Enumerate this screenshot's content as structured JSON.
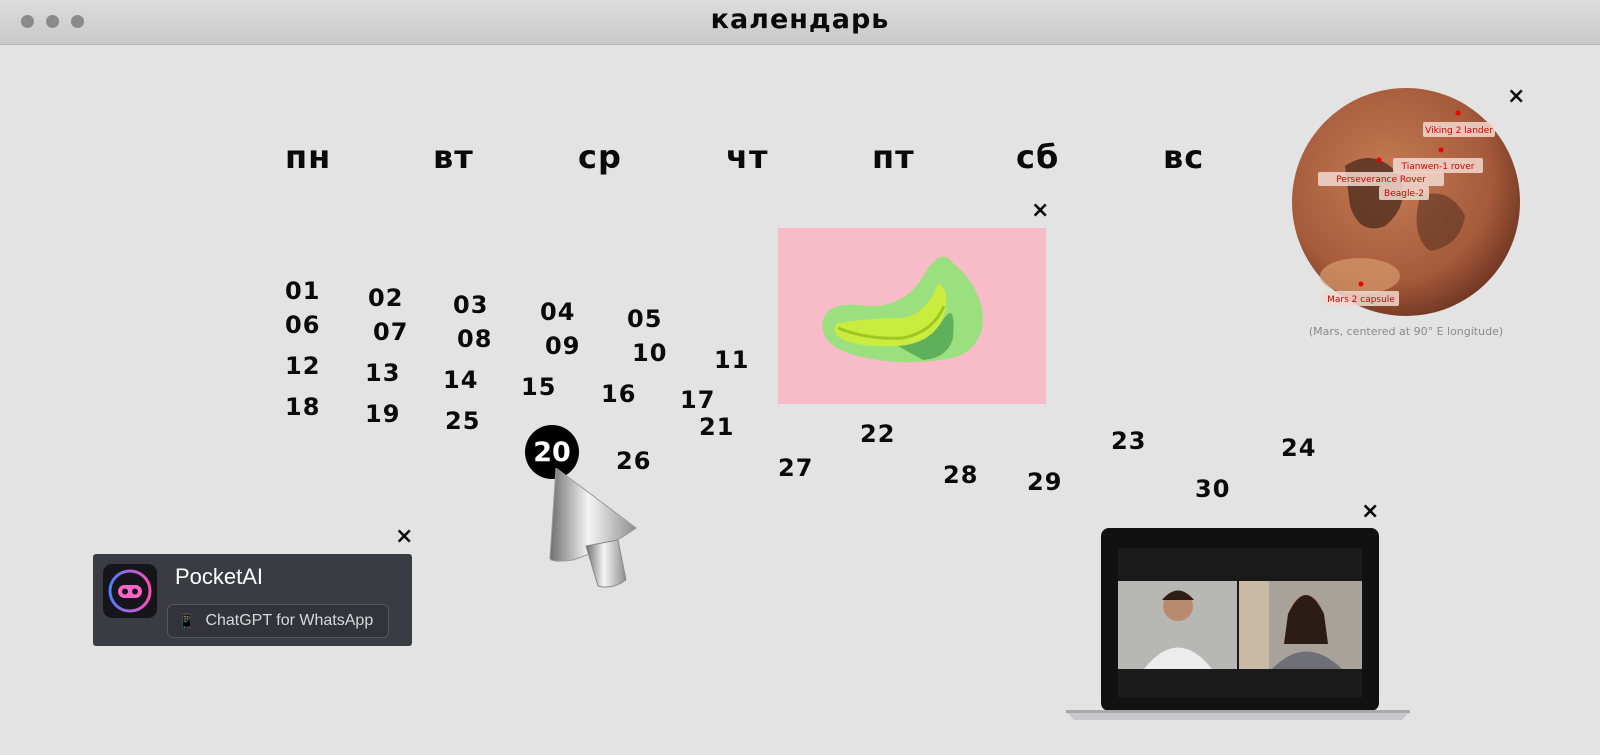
{
  "window": {
    "title": "календарь"
  },
  "weekdays": [
    "пн",
    "вт",
    "ср",
    "чт",
    "пт",
    "сб",
    "вс"
  ],
  "days": [
    "01",
    "02",
    "03",
    "04",
    "05",
    "06",
    "07",
    "08",
    "09",
    "10",
    "11",
    "12",
    "13",
    "14",
    "15",
    "16",
    "17",
    "18",
    "19",
    "20",
    "21",
    "22",
    "23",
    "24",
    "25",
    "26",
    "27",
    "28",
    "29",
    "30"
  ],
  "selected_day": "20",
  "close_glyph": "×",
  "mars": {
    "labels": [
      "Viking 2 lander",
      "Tianwen-1 rover",
      "Perseverance Rover",
      "Beagle-2",
      "Mars 2 capsule"
    ],
    "caption": "(Mars, centered at 90° E longitude)"
  },
  "pocketai": {
    "name": "PocketAI",
    "button_label": "ChatGPT for WhatsApp",
    "button_icon": "📱"
  },
  "icons": {
    "banana": "banana-image",
    "mars": "mars-globe-image",
    "cursor": "3d-cursor-icon",
    "laptop": "laptop-video-call-image"
  },
  "colors": {
    "selected_day_bg": "#000000",
    "banana_bg": "#f7bcc7",
    "pocket_bg": "#3b3b44"
  }
}
